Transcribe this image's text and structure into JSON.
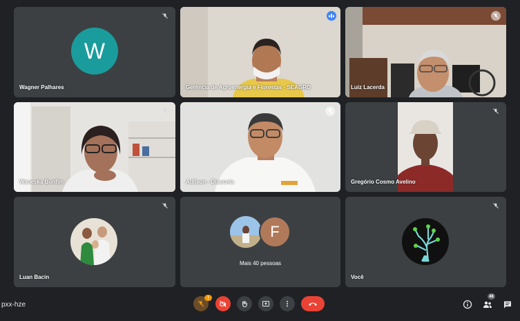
{
  "participants": [
    {
      "name": "Wagner Palhares",
      "avatar_letter": "W",
      "avatar_color": "#1a9c9c",
      "muted": true
    },
    {
      "name": "Gerência de Agroenergia e Florestas - SEAGRO",
      "speaking": true
    },
    {
      "name": "Luiz Lacerda",
      "muted": true
    },
    {
      "name": "Waneska Bonfim",
      "muted": true
    },
    {
      "name": "Adilson - Diaconia",
      "muted": true
    },
    {
      "name": "Gregório Cosmo Avelino",
      "muted": true
    },
    {
      "name": "Luan Bacin",
      "muted": true
    },
    {
      "name": "",
      "others_text": "Mais 40 pessoas",
      "others_avatar_letter": "F",
      "others_avatar_color": "#b07a5a"
    },
    {
      "name": "Você",
      "muted": true
    }
  ],
  "toolbar": {
    "meeting_code": "pxx-hze",
    "mic_badge": "!",
    "people_count": "48",
    "icons": [
      "mic-off-icon",
      "camera-off-icon",
      "raise-hand-icon",
      "present-screen-icon",
      "more-options-icon",
      "hang-up-icon",
      "info-icon",
      "people-icon",
      "chat-icon"
    ]
  },
  "colors": {
    "background": "#202124",
    "tile": "#3c4043",
    "accent_blue": "#4285f4",
    "danger": "#ea4335",
    "warning": "#f29900"
  }
}
